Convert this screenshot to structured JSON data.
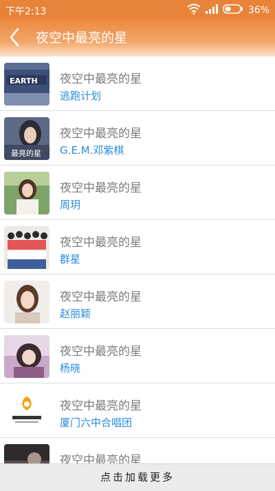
{
  "status_bar": {
    "time": "下午2:13",
    "battery": "36%",
    "icons": [
      "wifi-icon",
      "signal-icon",
      "battery-icon"
    ]
  },
  "header": {
    "title": "夜空中最亮的星",
    "back_icon": "chevron-left-icon"
  },
  "songs": [
    {
      "title": "夜空中最亮的星",
      "artist": "逃跑计划"
    },
    {
      "title": "夜空中最亮的星",
      "artist": "G.E.M.邓紫棋"
    },
    {
      "title": "夜空中最亮的星",
      "artist": "周玥"
    },
    {
      "title": "夜空中最亮的星",
      "artist": "群星"
    },
    {
      "title": "夜空中最亮的星",
      "artist": "赵丽颖"
    },
    {
      "title": "夜空中最亮的星",
      "artist": "杨晓"
    },
    {
      "title": "夜空中最亮的星",
      "artist": "厦门六中合唱团"
    },
    {
      "title": "夜空中最亮的星",
      "artist": ""
    }
  ],
  "load_more_label": "点击加载更多",
  "colors": {
    "accent": "#e8833a",
    "artist_text": "#2a8ad9",
    "title_text": "#7b7b7b"
  }
}
